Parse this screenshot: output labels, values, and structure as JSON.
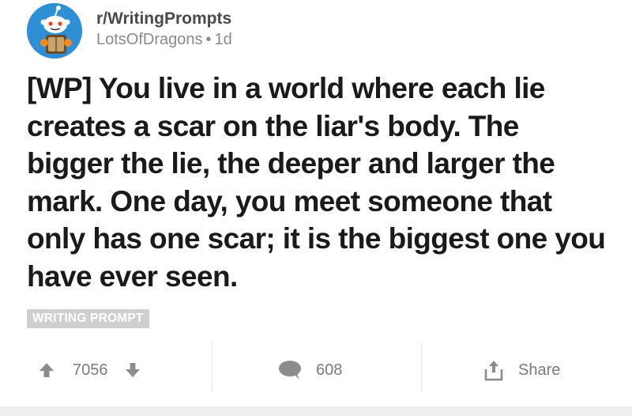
{
  "post": {
    "subreddit": "r/WritingPrompts",
    "author": "LotsOfDragons",
    "separator": "•",
    "age": "1d",
    "avatar_icon": "snoo-avatar-icon",
    "title": "[WP] You live in a world where each lie creates a scar on the liar's body. The bigger the lie, the deeper and larger the mark. One day, you meet someone that only has one scar; it is the biggest one you have ever seen.",
    "flair": "WRITING PROMPT"
  },
  "actions": {
    "score": "7056",
    "upvote_icon": "arrow-up-icon",
    "downvote_icon": "arrow-down-icon",
    "comment_count": "608",
    "comment_icon": "speech-bubble-icon",
    "share_label": "Share",
    "share_icon": "share-icon"
  },
  "colors": {
    "avatar_bg": "#2f8fd4",
    "flair_bg": "#cfcfcf",
    "icon_gray": "#8c8c8c",
    "title_text": "#1a1a1b"
  }
}
